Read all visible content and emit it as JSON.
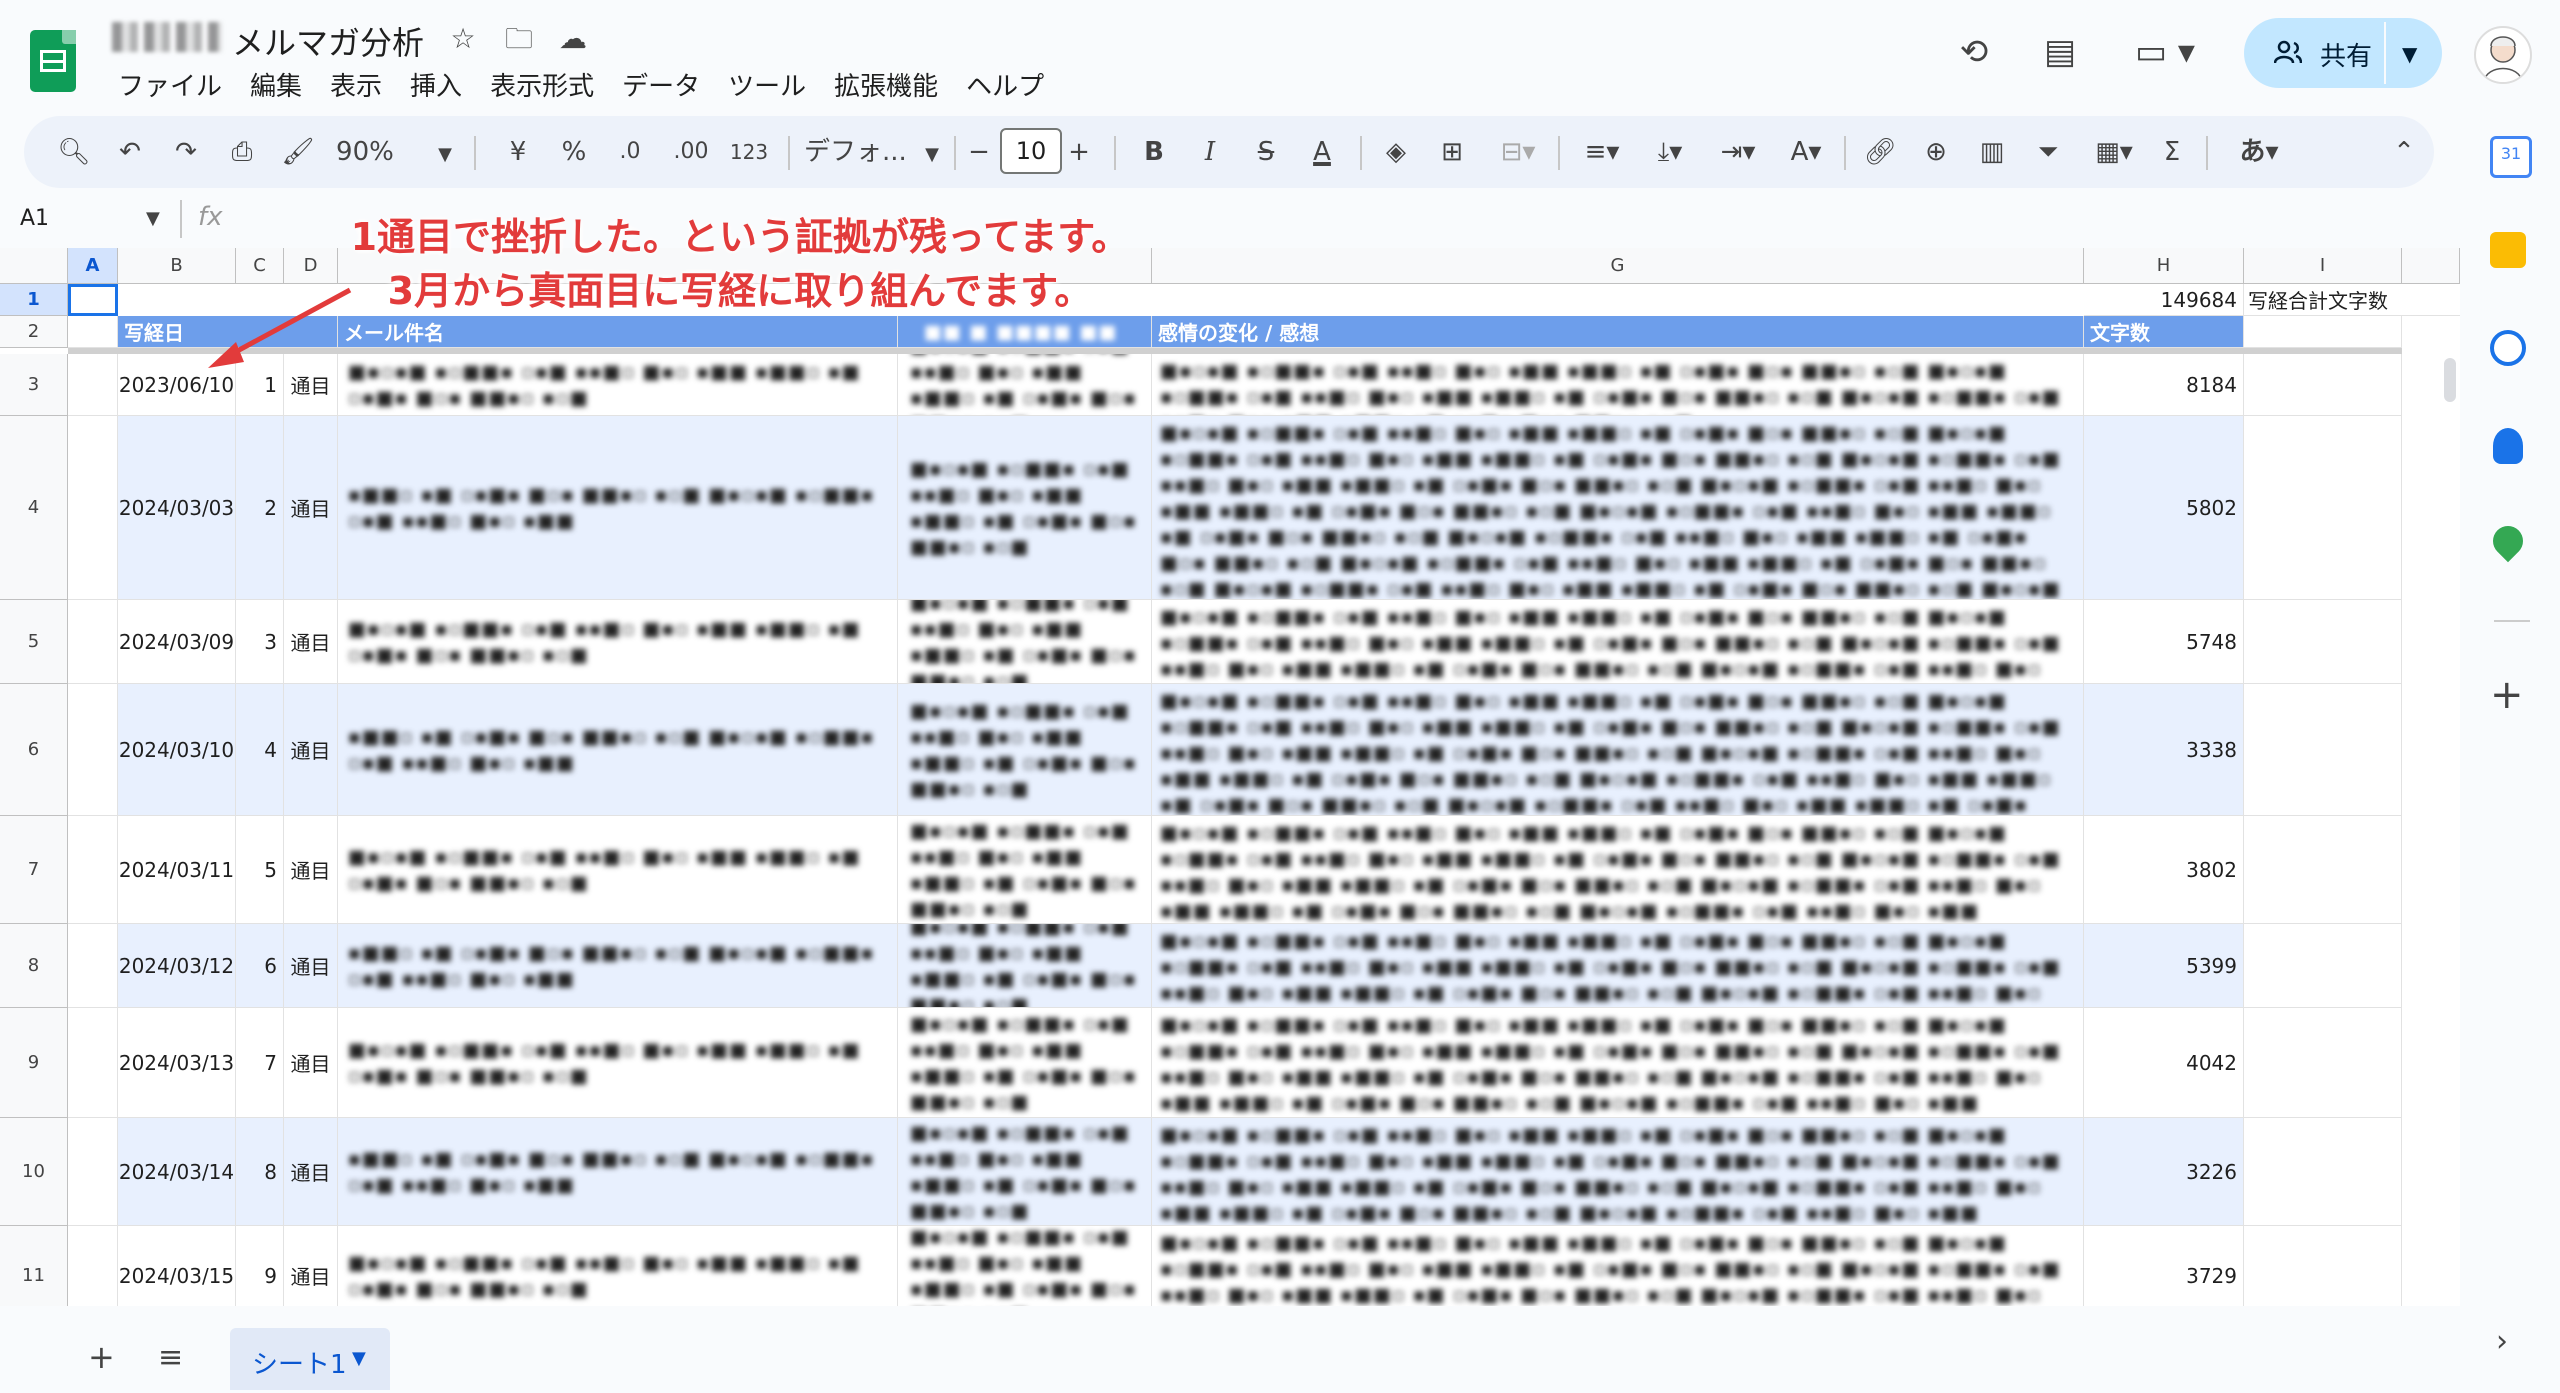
{
  "app": {
    "doc_title": "メルマガ分析"
  },
  "menu": [
    "ファイル",
    "編集",
    "表示",
    "挿入",
    "表示形式",
    "データ",
    "ツール",
    "拡張機能",
    "ヘルプ"
  ],
  "header": {
    "share_label": "共有"
  },
  "toolbar": {
    "zoom": "90%",
    "currency": "¥",
    "percent": "%",
    "dec_dec": ".0",
    "dec_inc": ".00",
    "format_123": "123",
    "font": "デフォ...",
    "font_size": "10"
  },
  "formula_bar": {
    "cell_ref": "A1",
    "fx": "fx"
  },
  "columns": [
    "A",
    "B",
    "C",
    "D",
    "",
    "G",
    "H",
    "I"
  ],
  "row1": {
    "h": "149684",
    "i": "写経合計文字数"
  },
  "header_row": {
    "b": "写経日",
    "e": "メール件名",
    "g": "感情の変化 / 感想",
    "h": "文字数"
  },
  "rows": [
    {
      "num": "3",
      "date": "2023/06/10",
      "c": "1",
      "d": "通目",
      "h": "8184"
    },
    {
      "num": "4",
      "date": "2024/03/03",
      "c": "2",
      "d": "通目",
      "h": "5802"
    },
    {
      "num": "5",
      "date": "2024/03/09",
      "c": "3",
      "d": "通目",
      "h": "5748"
    },
    {
      "num": "6",
      "date": "2024/03/10",
      "c": "4",
      "d": "通目",
      "h": "3338"
    },
    {
      "num": "7",
      "date": "2024/03/11",
      "c": "5",
      "d": "通目",
      "h": "3802"
    },
    {
      "num": "8",
      "date": "2024/03/12",
      "c": "6",
      "d": "通目",
      "h": "5399"
    },
    {
      "num": "9",
      "date": "2024/03/13",
      "c": "7",
      "d": "通目",
      "h": "4042"
    },
    {
      "num": "10",
      "date": "2024/03/14",
      "c": "8",
      "d": "通目",
      "h": "3226"
    },
    {
      "num": "11",
      "date": "2024/03/15",
      "c": "9",
      "d": "通目",
      "h": "3729"
    }
  ],
  "row_headers": [
    "1",
    "2"
  ],
  "annotation": {
    "line1": "1通目で挫折した。という証拠が残ってます。",
    "line2": "3月から真面目に写経に取り組んでます。"
  },
  "bottom": {
    "sheet_name": "シート1"
  }
}
